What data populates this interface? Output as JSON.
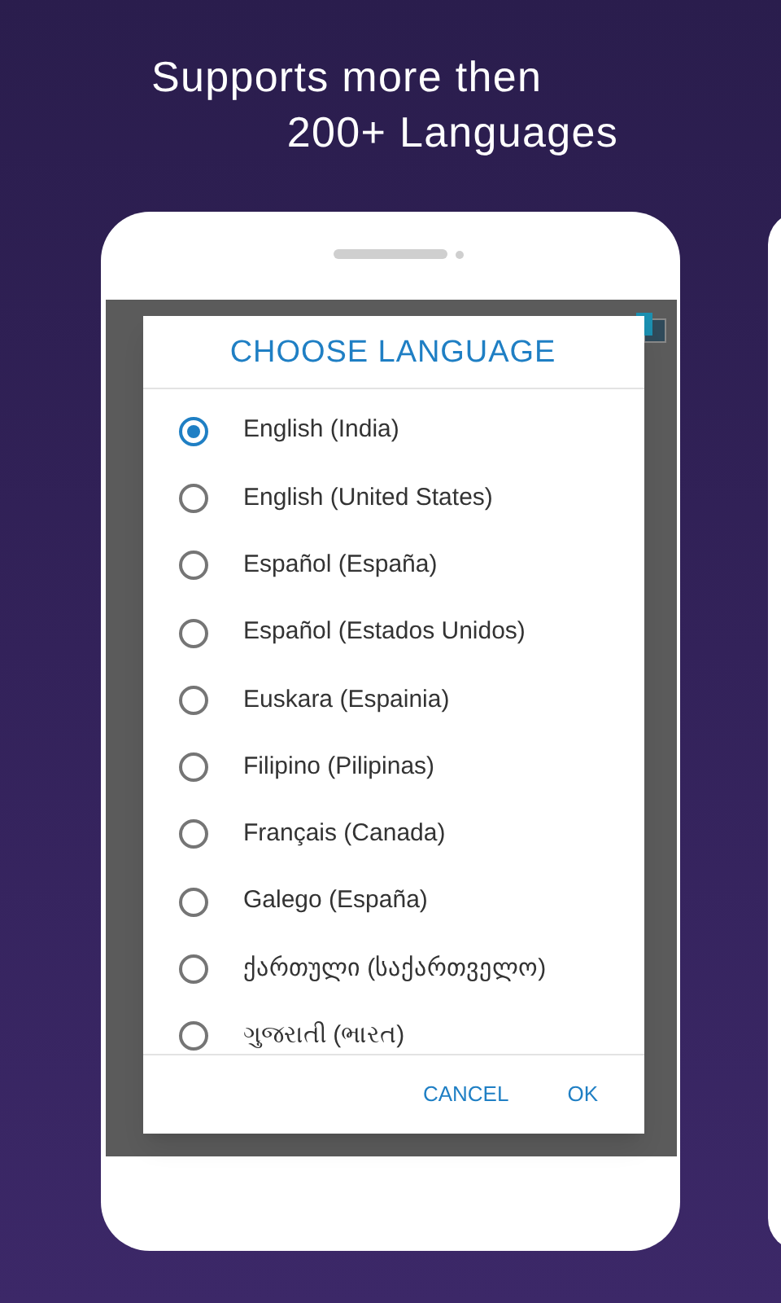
{
  "headline": [
    "Supports more then",
    "200+ Languages"
  ],
  "dialog": {
    "title": "CHOOSE LANGUAGE",
    "options": [
      {
        "label": "English (India)",
        "selected": true
      },
      {
        "label": "English (United States)",
        "selected": false
      },
      {
        "label": "Español (España)",
        "selected": false
      },
      {
        "label": "Español (Estados Unidos)",
        "selected": false
      },
      {
        "label": "Euskara (Espainia)",
        "selected": false
      },
      {
        "label": "Filipino (Pilipinas)",
        "selected": false
      },
      {
        "label": "Français (Canada)",
        "selected": false
      },
      {
        "label": "Galego (España)",
        "selected": false
      },
      {
        "label": "ქართული (საქართველო)",
        "selected": false
      },
      {
        "label": "ગુજરાતી (ભારત)",
        "selected": false
      }
    ],
    "buttons": [
      "CANCEL",
      "OK"
    ]
  }
}
